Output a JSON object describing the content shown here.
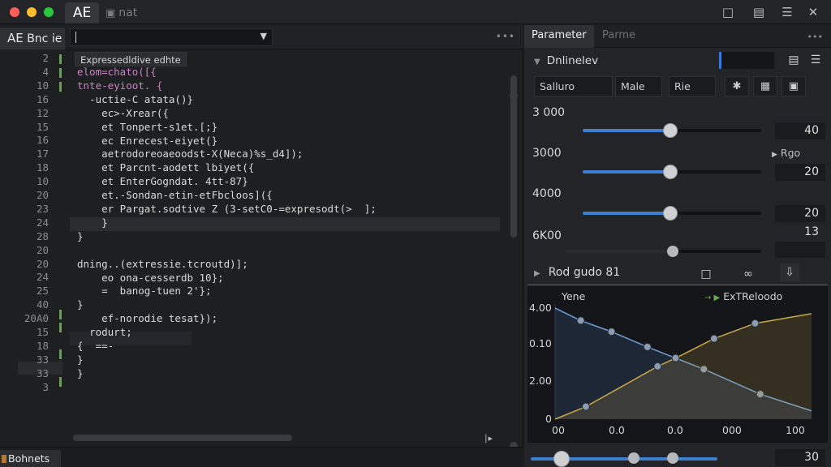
{
  "titlebar": {
    "app_tab": "AE",
    "second_tab": "nat",
    "icons": [
      "clipboard-icon",
      "calendar-icon",
      "settings-sliders-icon",
      "close-icon"
    ]
  },
  "editor": {
    "tab_label": "AE",
    "tab_suffix": "Bnc ie",
    "hint": "Expressedldive edhte",
    "line_numbers": [
      "2",
      "4",
      "10",
      "16",
      "12",
      "15",
      "16",
      "17",
      "18",
      "10",
      "20",
      "23",
      "24",
      "28",
      "20",
      "20",
      "24",
      "25",
      "40",
      "20A0",
      "15",
      "18",
      "33",
      "33",
      "3"
    ],
    "lines": [
      {
        "indent": "",
        "text": "elom=chato([{"
      },
      {
        "indent": "",
        "text": "tnte-eyioot. {"
      },
      {
        "indent": "  ",
        "text": "-uctie-C atata()}"
      },
      {
        "indent": "    ",
        "text": "ec>-Xrear({"
      },
      {
        "indent": "    ",
        "text": "et Tonpert-s1et.[;}"
      },
      {
        "indent": "    ",
        "text": "ec Enrecest-eiyet(}"
      },
      {
        "indent": "    ",
        "text": "aetrodoreoaeoodst-X(Neca)%s_d4]);"
      },
      {
        "indent": "    ",
        "text": "et Parcnt-aodett lbiyet({"
      },
      {
        "indent": "    ",
        "text": "et EnterGogndat. 4tt-87}"
      },
      {
        "indent": "    ",
        "text": "et.-Sondan-etin-etFbcloos]({"
      },
      {
        "indent": "    ",
        "text": "er Pargat.sodtive Z (3-setC0-=expresodt(>  ];"
      },
      {
        "indent": "    ",
        "text": "}"
      },
      {
        "indent": "",
        "text": "}"
      },
      {
        "indent": "",
        "text": ""
      },
      {
        "indent": "",
        "text": "dning..(extressie.tcroutd)];"
      },
      {
        "indent": "    ",
        "text": "eo ona-cesserdb 10};"
      },
      {
        "indent": "    ",
        "text": "=  banog-tuen 2'};"
      },
      {
        "indent": "",
        "text": "}"
      },
      {
        "indent": "    ",
        "text": "ef-norodie tesat});"
      },
      {
        "indent": "  ",
        "text": "rodurt;"
      },
      {
        "indent": "",
        "text": "{  ==-"
      },
      {
        "indent": "",
        "text": "}"
      },
      {
        "indent": "",
        "text": "}"
      },
      {
        "indent": "",
        "text": ""
      },
      {
        "indent": "",
        "text": ""
      }
    ],
    "bookmarks_label": "Bohnets"
  },
  "params": {
    "tabs": [
      "Parameter",
      "Parme"
    ],
    "section_label": "Dnlinelev",
    "fields": [
      {
        "label": "Salluro",
        "width": "wide"
      },
      {
        "label": "Male",
        "width": "mid"
      },
      {
        "label": "Rie",
        "width": "narrow"
      }
    ],
    "sliders": [
      {
        "label": "3 000",
        "value": "40",
        "fraction": 0.49
      },
      {
        "label": "3000",
        "value": "20",
        "fraction": 0.49
      },
      {
        "label": "4000",
        "value": "20",
        "fraction": 0.49
      },
      {
        "label": "6K00",
        "value": "13",
        "fraction": 0.55
      }
    ],
    "side_label": "Rgo",
    "section2_label": "Rod gudo 81",
    "graph": {
      "title": "Yene",
      "legend": "ExTReloodo",
      "y_ticks": [
        "4.00",
        "0.10",
        "2.00",
        "0"
      ],
      "x_ticks": [
        "00",
        "0.0",
        "0.0",
        "000",
        "100"
      ]
    },
    "bottom_value": "30"
  },
  "chart_data": {
    "type": "line",
    "title": "Yene",
    "x_ticks": [
      "00",
      "0.0",
      "0.0",
      "000",
      "100"
    ],
    "y_ticks": [
      "4.00",
      "0.10",
      "2.00",
      "0"
    ],
    "series": [
      {
        "name": "ExTReloodo",
        "points": [
          [
            0.0,
            4.0
          ],
          [
            0.1,
            3.55
          ],
          [
            0.22,
            3.15
          ],
          [
            0.36,
            2.6
          ],
          [
            0.47,
            2.2
          ],
          [
            0.58,
            1.8
          ],
          [
            0.8,
            0.9
          ],
          [
            1.0,
            0.3
          ]
        ]
      },
      {
        "points": [
          [
            0.0,
            0.0
          ],
          [
            0.12,
            0.45
          ],
          [
            0.4,
            1.9
          ],
          [
            0.47,
            2.2
          ],
          [
            0.62,
            2.9
          ],
          [
            0.78,
            3.45
          ],
          [
            1.0,
            3.8
          ]
        ]
      }
    ]
  },
  "colors": {
    "accent": "#3f7fd0",
    "keyword": "#c882c8",
    "string": "#7ec48a",
    "gutter_mark": "#5fa844",
    "curve_a": "#3a5f8c",
    "curve_b": "#c8a84a"
  }
}
